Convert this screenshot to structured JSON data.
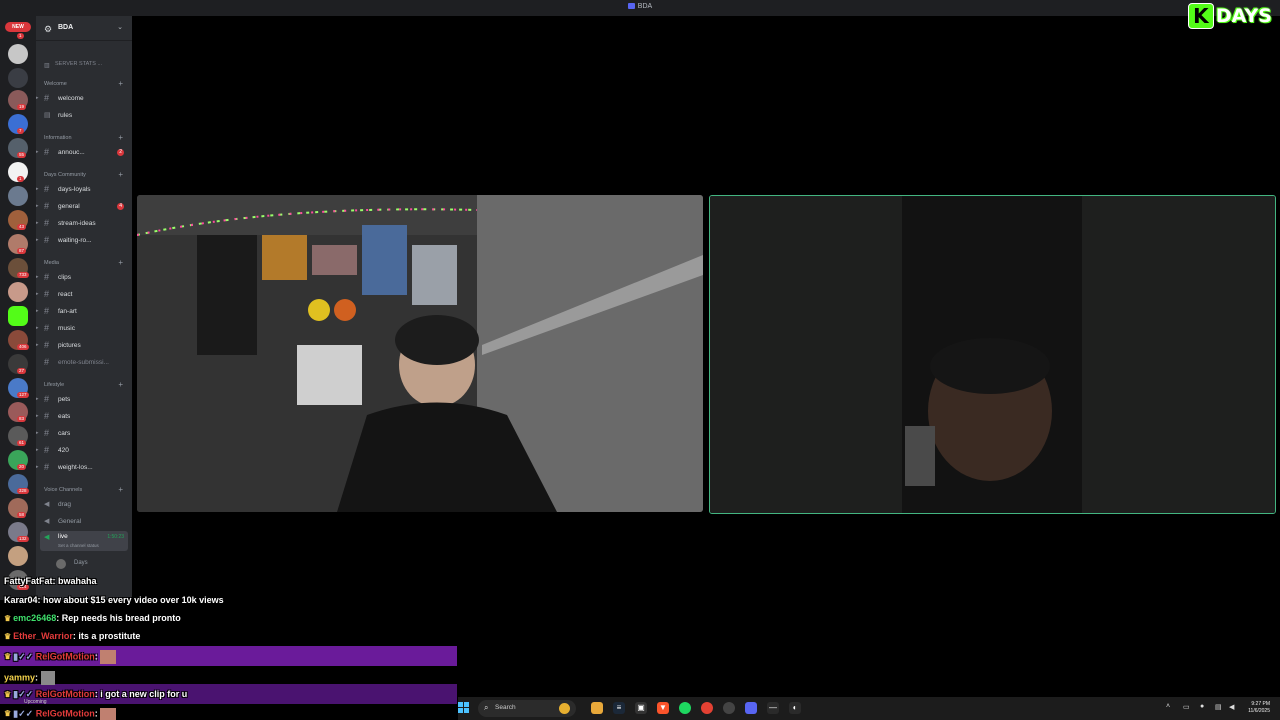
{
  "window": {
    "title": "BDA"
  },
  "brand": {
    "logo_letter": "K",
    "logo_word": "DAYS",
    "accent": "#53fc18"
  },
  "rail": {
    "new_badge": "NEW",
    "badges": [
      "1",
      "19",
      "7",
      "55",
      "1",
      "43",
      "87",
      "733",
      "406",
      "27",
      "127",
      "83",
      "61",
      "20",
      "328",
      "58",
      "132",
      "424"
    ]
  },
  "server": {
    "name": "BDA",
    "stats_label": "SERVER STATS ..."
  },
  "sidebar": {
    "categories": {
      "welcome": "Welcome",
      "information": "Information",
      "days_community": "Days Community",
      "media": "Media",
      "lifestyle": "Lifestyle",
      "voice": "Voice Channels"
    },
    "channels": {
      "welcome": "welcome",
      "rules": "rules",
      "announcements": "annouc...",
      "announcements_badge": "2",
      "days_loyals": "days-loyals",
      "general": "general",
      "general_badge": "4",
      "stream_ideas": "stream-ideas",
      "waiting_room": "waiting-ro...",
      "clips": "clips",
      "react": "react",
      "fan_art": "fan-art",
      "music": "music",
      "pictures": "pictures",
      "emote_submissions": "emote-submissi...",
      "pets": "pets",
      "eats": "eats",
      "cars": "cars",
      "four_twenty": "420",
      "weight_loss": "weight-los..."
    },
    "voice": {
      "drag": "drag",
      "general": "General",
      "live": "live",
      "live_time": "1:50:23",
      "live_status": "Set a channel status",
      "member": "Days"
    }
  },
  "chat": [
    {
      "user": "FattyFatFat",
      "text": "bwahaha",
      "color": "white"
    },
    {
      "user": "Karar04",
      "text": "how about $15 every video over 10k views",
      "color": "white"
    },
    {
      "user": "emc26468",
      "text": "Rep needs his bread pronto",
      "color": "green"
    },
    {
      "user": "Ether_Warrior",
      "text": "its a prostitute",
      "color": "red"
    },
    {
      "user": "RelGotMotion",
      "text": "",
      "color": "red"
    },
    {
      "user": "yammy",
      "text": "",
      "color": "yellow"
    },
    {
      "user": "RelGotMotion",
      "text": "i got a new clip for u",
      "color": "red"
    },
    {
      "user": "RelGotMotion",
      "text": "",
      "color": "red"
    }
  ],
  "taskbar": {
    "search_placeholder": "Search",
    "time": "9:27 PM",
    "date": "11/6/2025",
    "upcoming": "Upcoming"
  }
}
